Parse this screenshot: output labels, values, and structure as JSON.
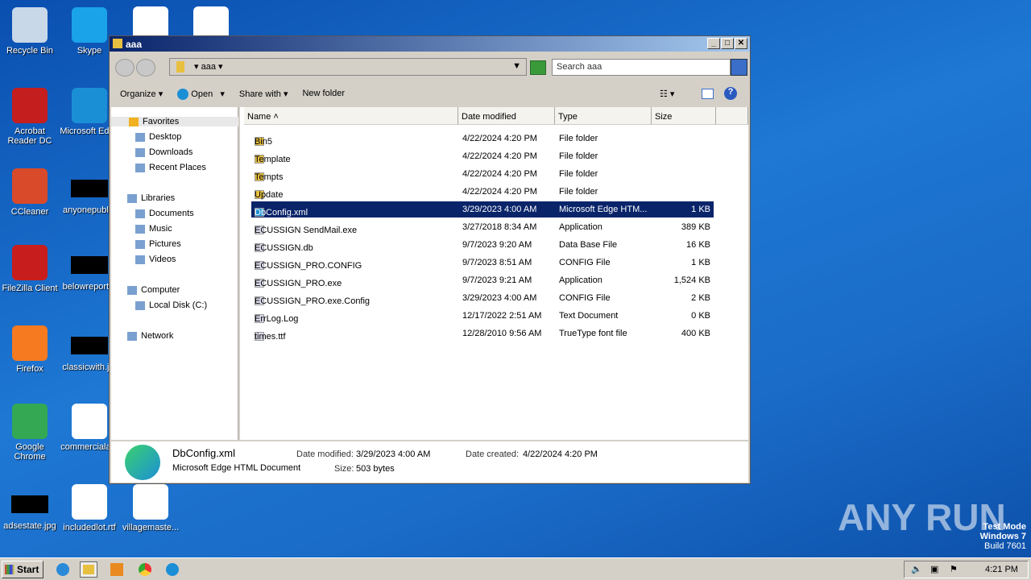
{
  "desktop": {
    "icons": [
      {
        "label": "Recycle Bin",
        "color": "#c8d8e8"
      },
      {
        "label": "Skype",
        "color": "#1aa3e8"
      },
      {
        "label": "Acrobat Reader DC",
        "color": "#c41e1e"
      },
      {
        "label": "Microsoft Edge",
        "color": "#1b8fd6"
      },
      {
        "label": "CCleaner",
        "color": "#d94a2a"
      },
      {
        "label": "anyonepubl...",
        "color": "#000"
      },
      {
        "label": "FileZilla Client",
        "color": "#c71d1d"
      },
      {
        "label": "belowreport...",
        "color": "#000"
      },
      {
        "label": "Firefox",
        "color": "#f57a20"
      },
      {
        "label": "classicwith.j...",
        "color": "#000"
      },
      {
        "label": "Google Chrome",
        "color": "#34a853"
      },
      {
        "label": "commerciala...",
        "color": "#fff"
      },
      {
        "label": "adsestate.jpg",
        "color": "#000"
      },
      {
        "label": "includedlot.rtf",
        "color": "#fff"
      },
      {
        "label": "villagemaste...",
        "color": "#fff"
      }
    ]
  },
  "window": {
    "title": "aaa",
    "address": "aaa",
    "search_placeholder": "Search aaa",
    "toolbar": [
      "Organize",
      "Open",
      "Share with",
      "New folder"
    ],
    "nav": [
      "Favorites",
      "Desktop",
      "Downloads",
      "Recent Places",
      "Libraries",
      "Documents",
      "Music",
      "Pictures",
      "Videos",
      "Computer",
      "Local Disk (C:)",
      "Network"
    ],
    "columns": [
      "Name",
      "Date modified",
      "Type",
      "Size"
    ],
    "files": [
      {
        "name": "Bin5",
        "date": "4/22/2024 4:20 PM",
        "type": "File folder",
        "size": ""
      },
      {
        "name": "Template",
        "date": "4/22/2024 4:20 PM",
        "type": "File folder",
        "size": ""
      },
      {
        "name": "Tempts",
        "date": "4/22/2024 4:20 PM",
        "type": "File folder",
        "size": ""
      },
      {
        "name": "Update",
        "date": "4/22/2024 4:20 PM",
        "type": "File folder",
        "size": ""
      },
      {
        "name": "DbConfig.xml",
        "date": "3/29/2023 4:00 AM",
        "type": "Microsoft Edge HTM...",
        "size": "1 KB"
      },
      {
        "name": "ECUSSIGN SendMail.exe",
        "date": "3/27/2018 8:34 AM",
        "type": "Application",
        "size": "389 KB"
      },
      {
        "name": "ECUSSIGN.db",
        "date": "9/7/2023 9:20 AM",
        "type": "Data Base File",
        "size": "16 KB"
      },
      {
        "name": "ECUSSIGN_PRO.CONFIG",
        "date": "9/7/2023 8:51 AM",
        "type": "CONFIG File",
        "size": "1 KB"
      },
      {
        "name": "ECUSSIGN_PRO.exe",
        "date": "9/7/2023 9:21 AM",
        "type": "Application",
        "size": "1,524 KB"
      },
      {
        "name": "ECUSSIGN_PRO.exe.Config",
        "date": "3/29/2023 4:00 AM",
        "type": "CONFIG File",
        "size": "2 KB"
      },
      {
        "name": "ErrLog.Log",
        "date": "12/17/2022 2:51 AM",
        "type": "Text Document",
        "size": "0 KB"
      },
      {
        "name": "times.ttf",
        "date": "12/28/2010 9:56 AM",
        "type": "TrueType font file",
        "size": "400 KB"
      }
    ],
    "details": {
      "name": "DbConfig.xml",
      "type": "Microsoft Edge HTML Document",
      "modified_label": "Date modified:",
      "modified": "3/29/2023 4:00 AM",
      "created_label": "Date created:",
      "created": "4/22/2024 4:20 PM",
      "size_label": "Size:",
      "size": "503 bytes"
    }
  },
  "taskbar": {
    "start": "Start",
    "time": "4:21 PM"
  },
  "watermark": {
    "brand": "ANY RUN",
    "line1": "Test Mode",
    "line2": "Windows 7",
    "line3": "Build 7601"
  }
}
